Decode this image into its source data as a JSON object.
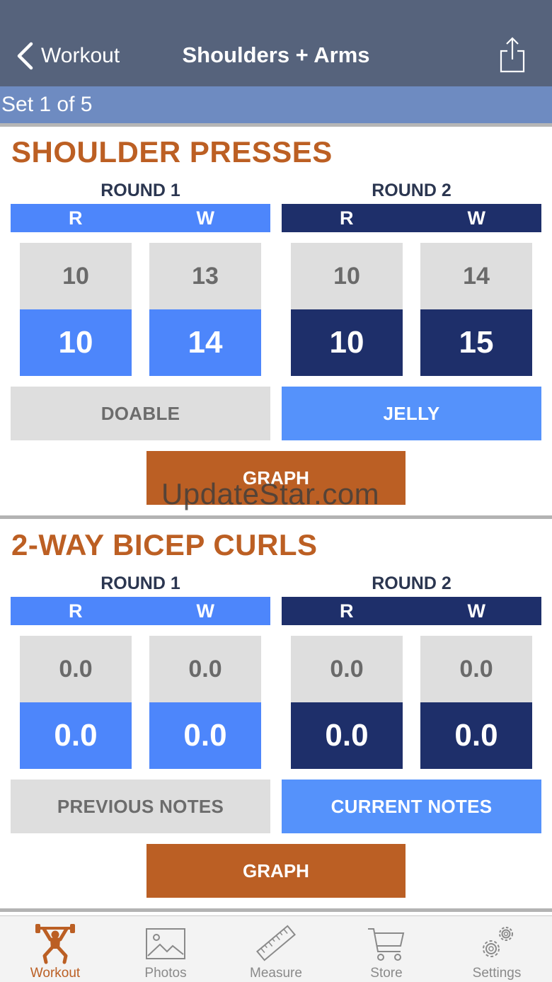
{
  "nav": {
    "back_label": "Workout",
    "title": "Shoulders + Arms"
  },
  "set_indicator": "Set 1 of 5",
  "exercises": [
    {
      "name": "SHOULDER PRESSES",
      "rounds": [
        {
          "label": "ROUND 1",
          "r_header": "R",
          "w_header": "W",
          "previous": {
            "r": "10",
            "w": "13"
          },
          "current": {
            "r": "10",
            "w": "14"
          }
        },
        {
          "label": "ROUND 2",
          "r_header": "R",
          "w_header": "W",
          "previous": {
            "r": "10",
            "w": "14"
          },
          "current": {
            "r": "10",
            "w": "15"
          }
        }
      ],
      "left_note": "DOABLE",
      "right_note": "JELLY",
      "graph_label": "GRAPH"
    },
    {
      "name": "2-WAY BICEP CURLS",
      "rounds": [
        {
          "label": "ROUND 1",
          "r_header": "R",
          "w_header": "W",
          "previous": {
            "r": "0.0",
            "w": "0.0"
          },
          "current": {
            "r": "0.0",
            "w": "0.0"
          }
        },
        {
          "label": "ROUND 2",
          "r_header": "R",
          "w_header": "W",
          "previous": {
            "r": "0.0",
            "w": "0.0"
          },
          "current": {
            "r": "0.0",
            "w": "0.0"
          }
        }
      ],
      "left_note": "PREVIOUS NOTES",
      "right_note": "CURRENT NOTES",
      "graph_label": "GRAPH"
    }
  ],
  "watermark": "UpdateStar.com",
  "tabs": [
    {
      "label": "Workout",
      "icon": "weightlifter-icon",
      "active": true
    },
    {
      "label": "Photos",
      "icon": "photo-icon",
      "active": false
    },
    {
      "label": "Measure",
      "icon": "ruler-icon",
      "active": false
    },
    {
      "label": "Store",
      "icon": "cart-icon",
      "active": false
    },
    {
      "label": "Settings",
      "icon": "gears-icon",
      "active": false
    }
  ],
  "colors": {
    "navbar": "#56637c",
    "set_bar": "#6e8bc1",
    "accent_orange": "#bb5f24",
    "round1_blue": "#4d86fb",
    "round2_navy": "#1e2f6a",
    "note_blue": "#5592fb",
    "cell_gray": "#dedede"
  }
}
